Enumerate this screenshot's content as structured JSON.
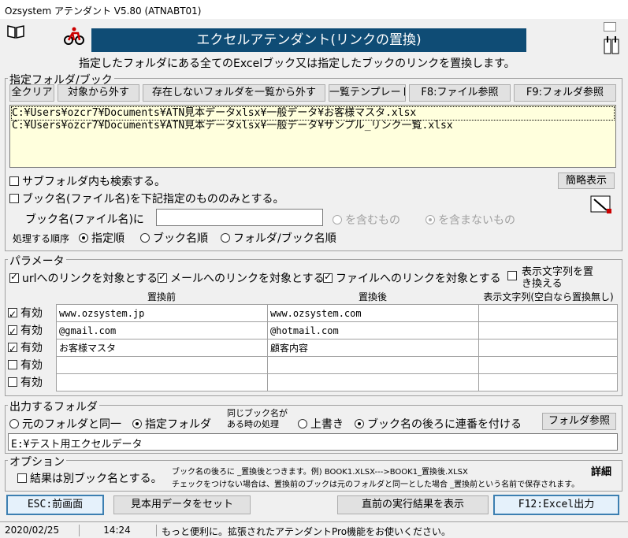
{
  "window": {
    "title": "Ozsystem アテンダント V5.80 (ATNABT01)"
  },
  "banner": {
    "title": "エクセルアテンダント(リンクの置換)"
  },
  "description": "指定したフォルダにある全てのExcelブック又は指定したブックのリンクを置換します。",
  "folder_group": {
    "label": "指定フォルダ/ブック",
    "buttons": {
      "clear": "全クリア",
      "remove": "対象から外す",
      "remove_missing": "存在しないフォルダを一覧から外す",
      "template": "一覧テンプレート",
      "f8": "F8:ファイル参照",
      "f9": "F9:フォルダ参照"
    },
    "files": [
      "C:¥Users¥ozcr7¥Documents¥ATN見本データxlsx¥一般データ¥お客様マスタ.xlsx",
      "C:¥Users¥ozcr7¥Documents¥ATN見本データxlsx¥一般データ¥サンプル_リンク一覧.xlsx"
    ],
    "search_subfolders": "サブフォルダ内も検索する。",
    "limit_books": "ブック名(ファイル名)を下記指定のもののみとする。",
    "book_name_label": "ブック名(ファイル名)に",
    "book_name_value": "",
    "contains": "を含むもの",
    "not_contains": "を含まないもの",
    "simple_view": "簡略表示",
    "order_label": "処理する順序",
    "order_options": [
      "指定順",
      "ブック名順",
      "フォルダ/ブック名順"
    ]
  },
  "params": {
    "label": "パラメータ",
    "url_links": "urlへのリンクを対象とする",
    "mail_links": "メールへのリンクを対象とする",
    "file_links": "ファイルへのリンクを対象とする",
    "replace_display_1": "表示文字列を置",
    "replace_display_2": "き換える",
    "col_before": "置換前",
    "col_after": "置換後",
    "col_display": "表示文字列(空白なら置換無し)",
    "rows": [
      {
        "enabled": true,
        "label": "有効",
        "before": "www.ozsystem.jp",
        "after": "www.ozsystem.com",
        "display": ""
      },
      {
        "enabled": true,
        "label": "有効",
        "before": "@gmail.com",
        "after": "@hotmail.com",
        "display": ""
      },
      {
        "enabled": true,
        "label": "有効",
        "before": "お客様マスタ",
        "after": "顧客内容",
        "display": ""
      },
      {
        "enabled": false,
        "label": "有効",
        "before": "",
        "after": "",
        "display": ""
      },
      {
        "enabled": false,
        "label": "有効",
        "before": "",
        "after": "",
        "display": ""
      }
    ]
  },
  "output": {
    "label": "出力するフォルダ",
    "same_folder": "元のフォルダと同一",
    "specified_folder": "指定フォルダ",
    "same_name_1": "同じブック名が",
    "same_name_2": "ある時の処理",
    "overwrite": "上書き",
    "append_number": "ブック名の後ろに連番を付ける",
    "folder_ref": "フォルダ参照",
    "path": "E:¥テスト用エクセルデータ"
  },
  "options": {
    "label": "オプション",
    "separate_book": "結果は別ブック名とする。",
    "note1": "ブック名の後ろに _置換後とつきます。例) BOOK1.XLSX--->BOOK1_置換後.XLSX",
    "note2": "チェックをつけない場合は、置換前のブックは元のフォルダと同一とした場合 _置換前という名前で保存されます。",
    "detail": "詳細"
  },
  "footer": {
    "esc": "ESC:前画面",
    "sample": "見本用データをセット",
    "last_result": "直前の実行結果を表示",
    "f12": "F12:Excel出力"
  },
  "status": {
    "date": "2020/02/25",
    "time": "14:24",
    "message": "もっと便利に。拡張されたアテンダントPro機能をお使いください。"
  }
}
